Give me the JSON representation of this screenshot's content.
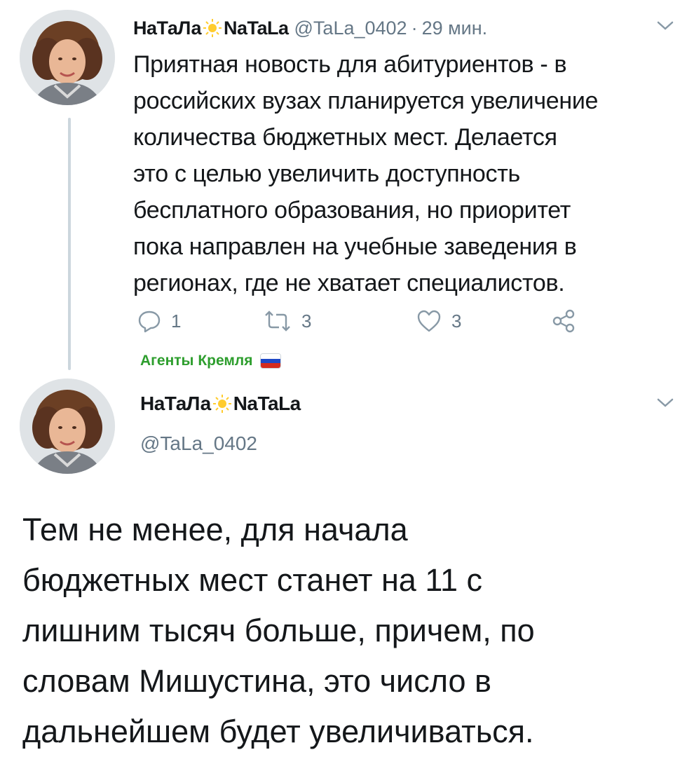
{
  "tweet1": {
    "author_name_part1": "НаТаЛа",
    "author_name_part2": "NaTaLa",
    "handle": "@TaLa_0402",
    "separator": "·",
    "time": "29 мин.",
    "text": "Приятная новость для абитуриентов - в\nроссийских вузах планируется увеличение\nколичества бюджетных мест. Делается\nэто с целью увеличить доступность\nбесплатного образования, но приоритет\nпока направлен на учебные заведения в\nрегионах, где не хватает специалистов.",
    "replies": "1",
    "retweets": "3",
    "likes": "3"
  },
  "tag_label": "Агенты Кремля",
  "tweet2": {
    "author_name_part1": "НаТаЛа",
    "author_name_part2": "NaTaLa",
    "handle": "@TaLa_0402",
    "text": "Тем не менее, для начала\nбюджетных мест станет на 11 с\nлишним тысяч больше, причем, по\nсловам Мишустина, это число в\nдальнейшем будет увеличиваться."
  },
  "icons": {
    "emoji": "sun-icon",
    "reply": "reply-icon",
    "retweet": "retweet-icon",
    "like": "heart-icon",
    "share": "share-icon",
    "more": "chevron-down-icon",
    "flag": "russia-flag-icon"
  },
  "colors": {
    "text": "#14171a",
    "secondary": "#657786",
    "tag_green": "#2e9e2e",
    "thread_line": "#ccd6dd"
  }
}
